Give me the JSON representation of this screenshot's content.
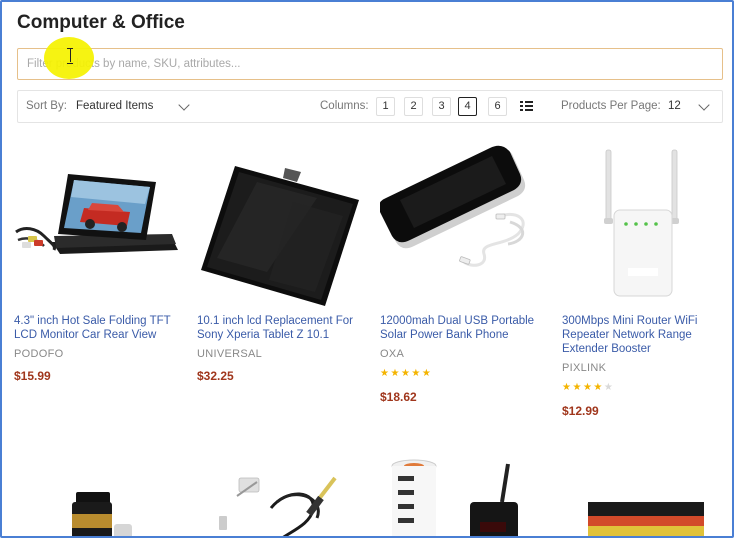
{
  "page": {
    "title": "Computer & Office"
  },
  "search": {
    "placeholder": "Filter products by name, SKU, attributes..."
  },
  "toolbar": {
    "sort_label": "Sort By:",
    "sort_value": "Featured Items",
    "columns_label": "Columns:",
    "column_options": [
      "1",
      "2",
      "3",
      "4",
      "6"
    ],
    "columns_selected": "4",
    "per_page_label": "Products Per Page:",
    "per_page_value": "12"
  },
  "products": [
    {
      "name": "4.3\" inch Hot Sale Folding TFT LCD Monitor Car Rear View",
      "brand": "PODOFO",
      "price": "$15.99",
      "rating": null,
      "image_icon": "car-monitor-icon"
    },
    {
      "name": "10.1 inch lcd Replacement For Sony Xperia Tablet Z 10.1",
      "brand": "UNIVERSAL",
      "price": "$32.25",
      "rating": null,
      "image_icon": "lcd-panel-icon"
    },
    {
      "name": "12000mah Dual USB Portable Solar Power Bank Phone",
      "brand": "OXA",
      "price": "$18.62",
      "rating": 5,
      "image_icon": "power-bank-icon"
    },
    {
      "name": "300Mbps Mini Router WiFi Repeater Network Range Extender Booster",
      "brand": "PIXLINK",
      "price": "$12.99",
      "rating": 4,
      "image_icon": "wifi-repeater-icon"
    }
  ],
  "row2_images": [
    "lens-icon",
    "soldering-iron-icon",
    "pager-stack-icon",
    "toner-cartridge-icon"
  ],
  "colors": {
    "link": "#3a5ba8",
    "price": "#a0361c",
    "star": "#f4b400",
    "accent_border": "#e6c08a",
    "frame": "#4a7fd4"
  }
}
